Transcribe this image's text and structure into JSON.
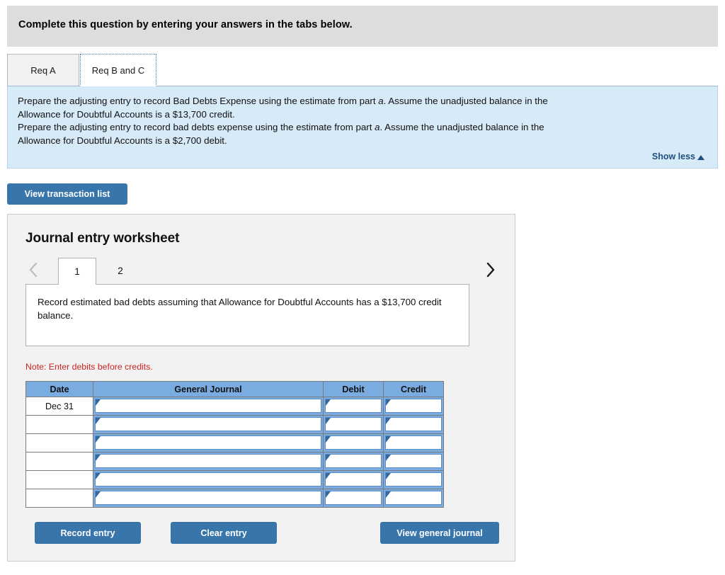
{
  "header": {
    "instruction": "Complete this question by entering your answers in the tabs below."
  },
  "tabs": [
    {
      "id": "req-a",
      "label": "Req A",
      "active": false
    },
    {
      "id": "req-b-and-c",
      "label": "Req B and C",
      "active": true
    }
  ],
  "requirement_panel": {
    "lines": [
      {
        "pre": "Prepare the adjusting entry to record Bad Debts Expense using the estimate from part ",
        "em": "a",
        "post": ". Assume the unadjusted balance in the"
      },
      {
        "pre": "Allowance for Doubtful Accounts is a $13,700 credit.",
        "em": "",
        "post": ""
      },
      {
        "pre": "Prepare the adjusting entry to record bad debts expense using the estimate from part ",
        "em": "a",
        "post": ". Assume the unadjusted balance in the"
      },
      {
        "pre": "Allowance for Doubtful Accounts is a $2,700 debit.",
        "em": "",
        "post": ""
      }
    ],
    "show_less_label": "Show less",
    "show_less_icon": "caret-up-icon",
    "background_color": "#d7eaf8"
  },
  "toolbar": {
    "view_transaction_list_label": "View transaction list"
  },
  "worksheet": {
    "title": "Journal entry worksheet",
    "pager": {
      "prev_icon": "chevron-left-icon",
      "next_icon": "chevron-right-icon",
      "prev_enabled": false,
      "next_enabled": true,
      "pages": [
        {
          "label": "1",
          "active": true
        },
        {
          "label": "2",
          "active": false
        }
      ]
    },
    "description": "Record estimated bad debts assuming that Allowance for Doubtful Accounts has a $13,700 credit balance.",
    "note": "Note: Enter debits before credits.",
    "table": {
      "columns": [
        "Date",
        "General Journal",
        "Debit",
        "Credit"
      ],
      "rows": [
        {
          "date": "Dec 31",
          "general_journal": "",
          "debit": "",
          "credit": ""
        },
        {
          "date": "",
          "general_journal": "",
          "debit": "",
          "credit": ""
        },
        {
          "date": "",
          "general_journal": "",
          "debit": "",
          "credit": ""
        },
        {
          "date": "",
          "general_journal": "",
          "debit": "",
          "credit": ""
        },
        {
          "date": "",
          "general_journal": "",
          "debit": "",
          "credit": ""
        },
        {
          "date": "",
          "general_journal": "",
          "debit": "",
          "credit": ""
        }
      ]
    },
    "buttons": {
      "record_entry": "Record entry",
      "clear_entry": "Clear entry",
      "view_general_journal": "View general journal"
    }
  },
  "colors": {
    "header_gray": "#dddddd",
    "panel_blue": "#d7eaf8",
    "button_blue": "#3875ab",
    "table_header_blue": "#7aace1",
    "note_red": "#cc2222",
    "link_navy": "#1d4f7c"
  }
}
